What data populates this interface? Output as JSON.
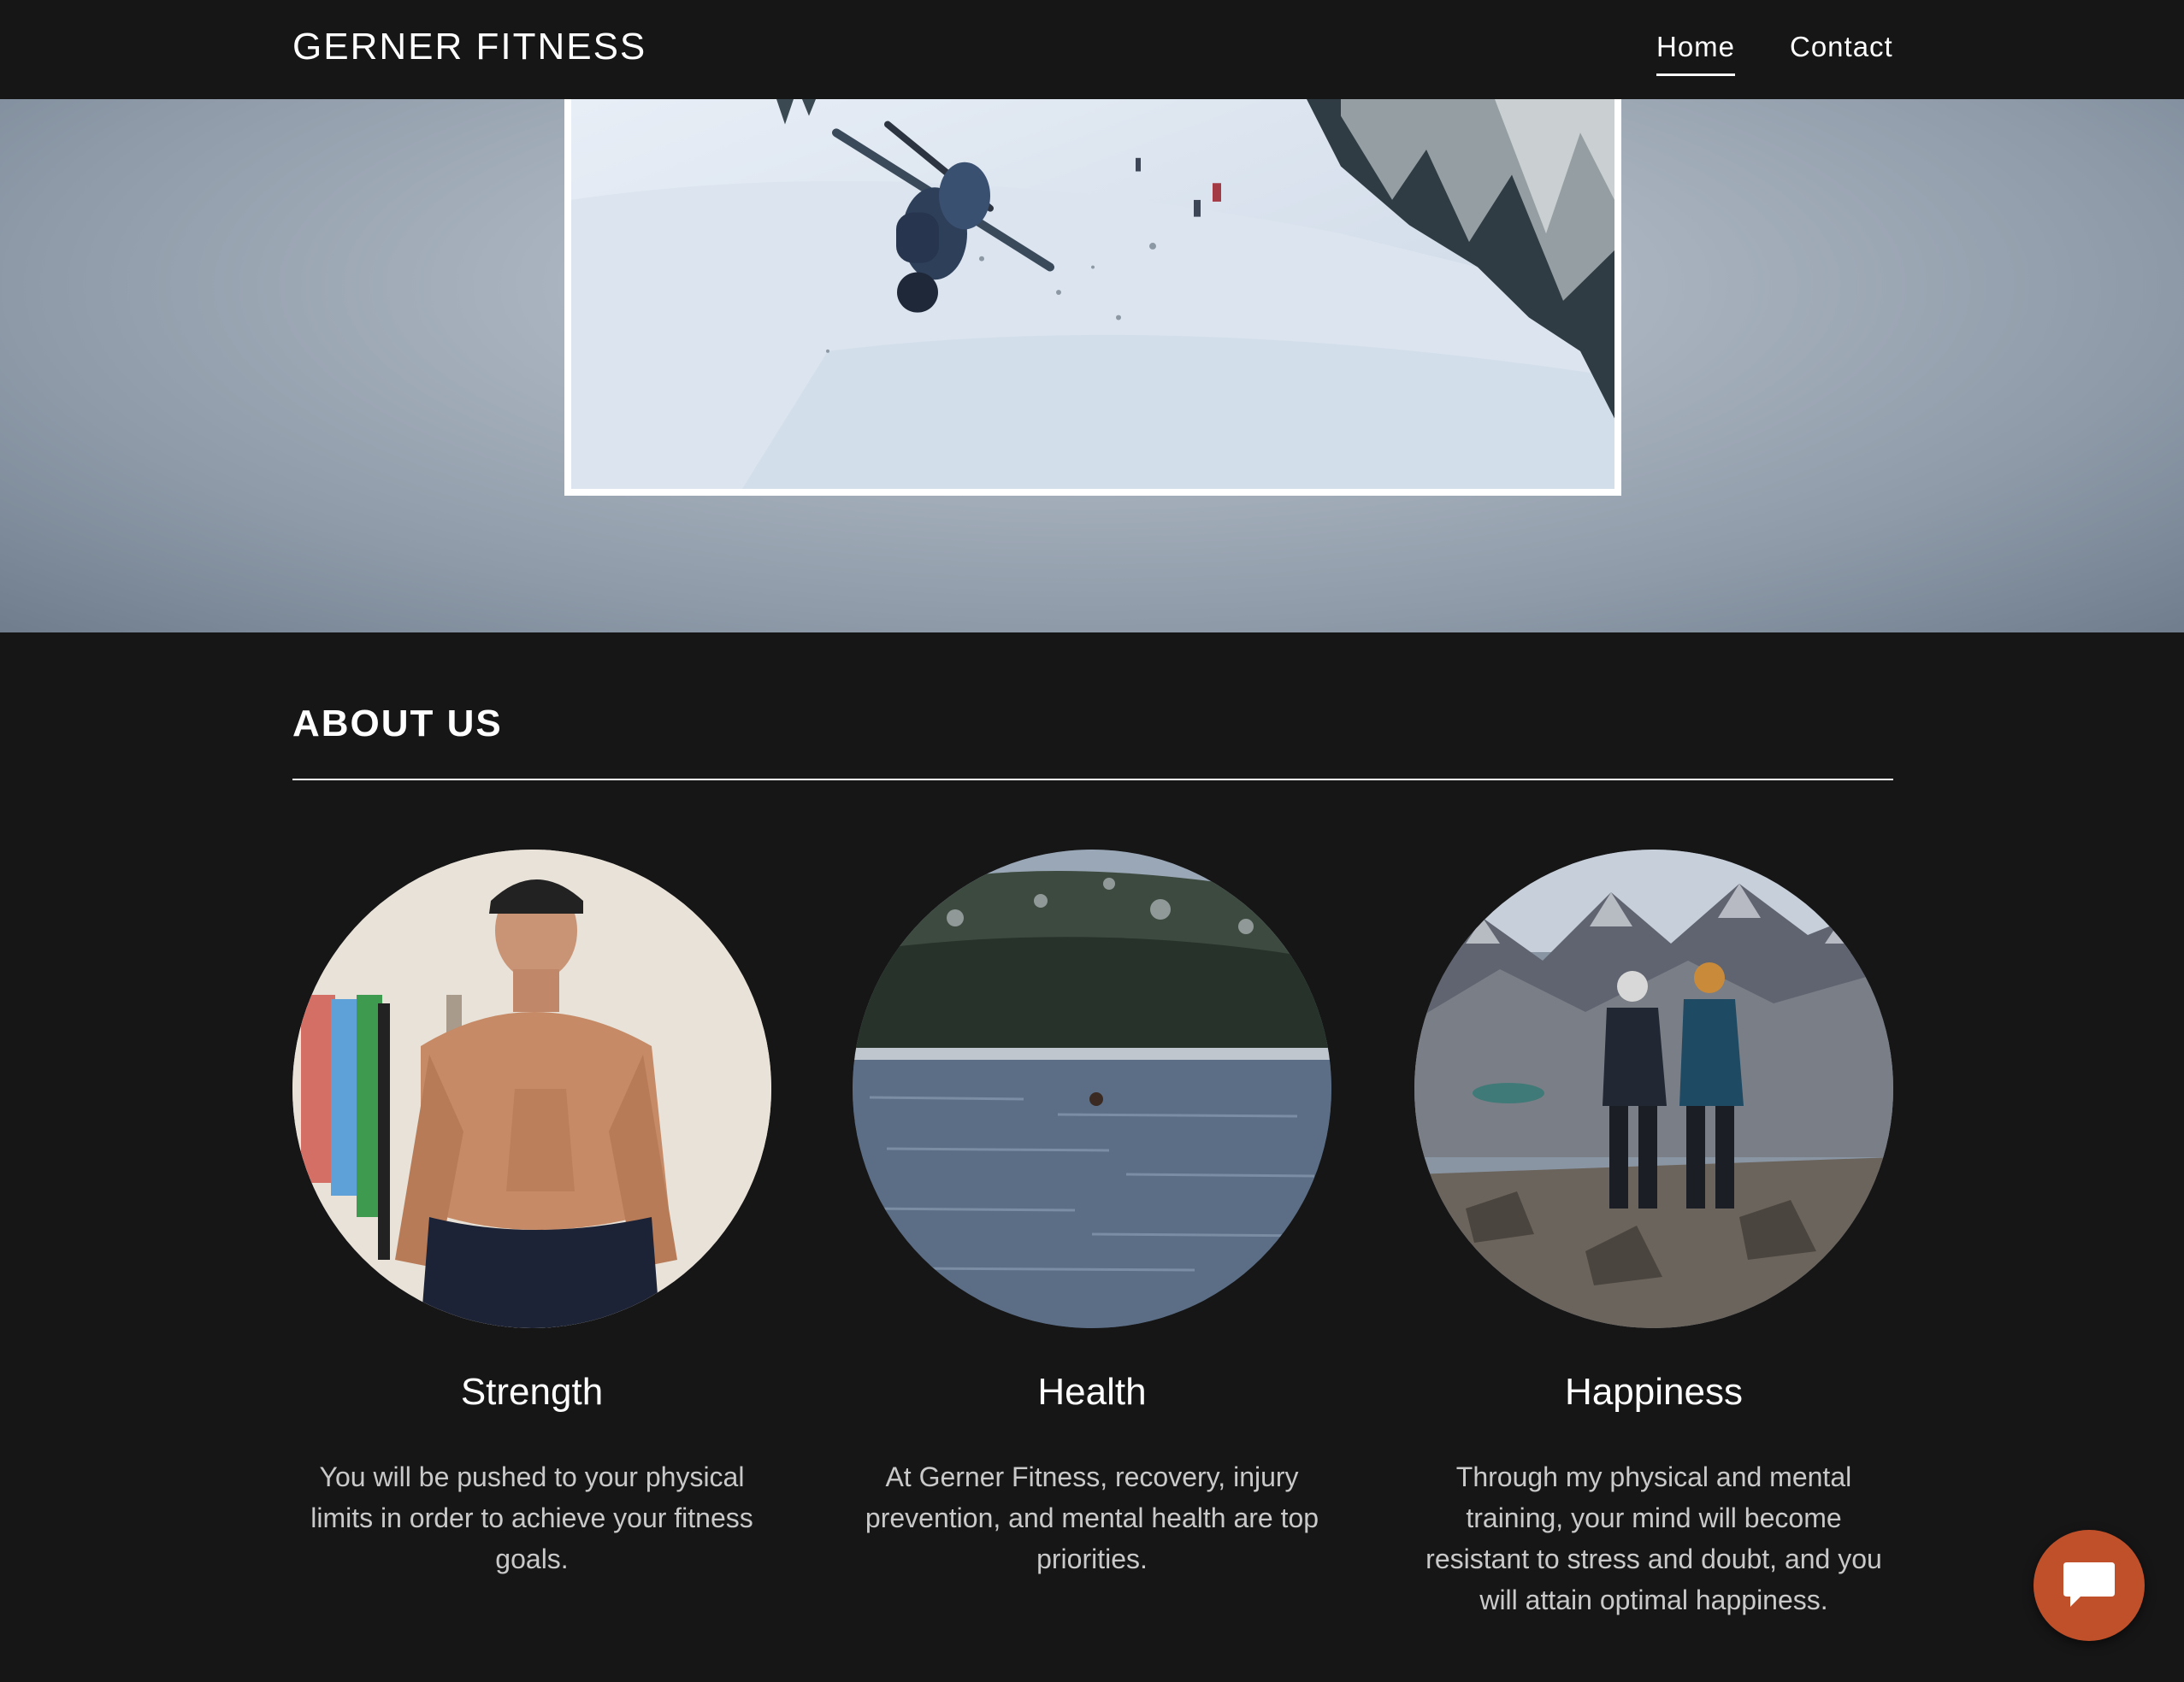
{
  "nav": {
    "brand": "GERNER FITNESS",
    "links": [
      {
        "label": "Home",
        "active": true
      },
      {
        "label": "Contact",
        "active": false
      }
    ]
  },
  "hero": {
    "media": "skier-backflip-video"
  },
  "about": {
    "title": "ABOUT US",
    "features": [
      {
        "title": "Strength",
        "text": "You will be pushed to your physical limits in order to achieve your fitness goals.",
        "image": "shirtless-athlete-photo"
      },
      {
        "title": "Health",
        "text": "At Gerner Fitness, recovery, injury prevention, and mental health are top priorities.",
        "image": "mountain-lake-swim-photo"
      },
      {
        "title": "Happiness",
        "text": "Through my physical and mental training, your mind will become resistant to stress and doubt, and you will attain optimal happiness.",
        "image": "mountain-hikers-photo"
      }
    ]
  },
  "chat": {
    "icon": "chat-bubble-icon",
    "color": "#c0502a"
  },
  "colors": {
    "background": "#161617",
    "text": "#ffffff",
    "muted_text": "#c9c9c9",
    "accent": "#c0502a"
  }
}
